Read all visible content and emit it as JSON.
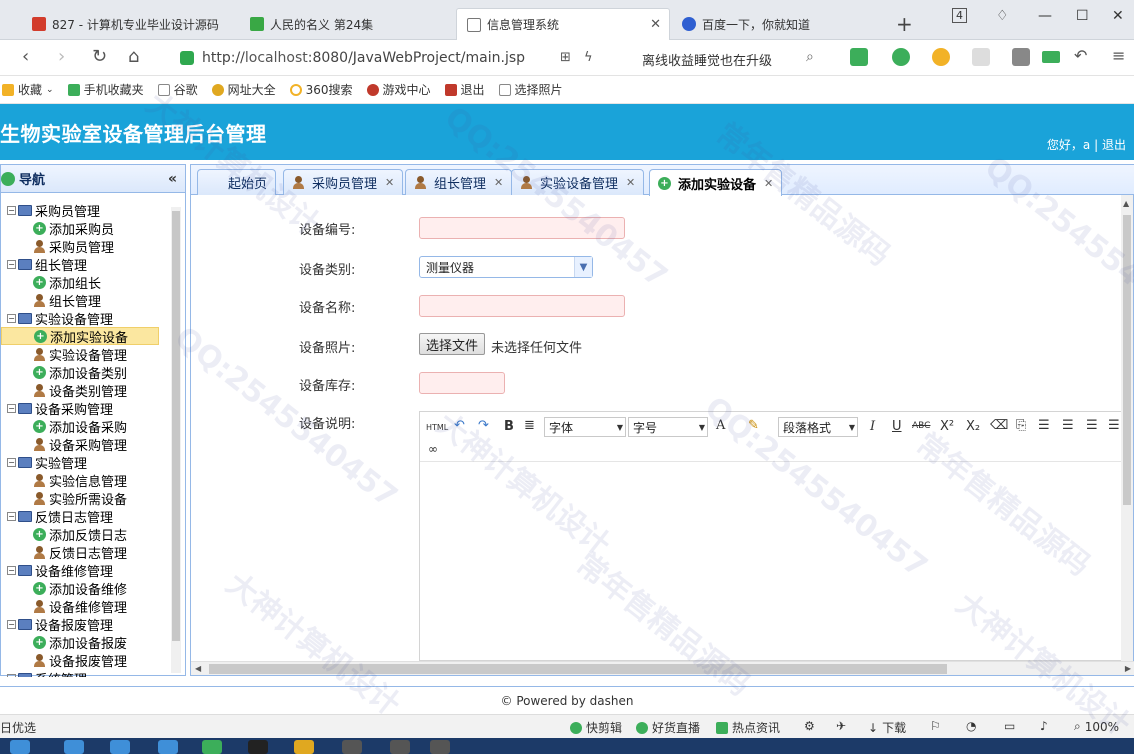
{
  "browser": {
    "tabs": [
      {
        "title": "827 - 计算机专业毕业设计源码"
      },
      {
        "title": "人民的名义 第24集"
      },
      {
        "title": "信息管理系统"
      },
      {
        "title": "百度一下，你就知道"
      }
    ],
    "tab_count_badge": "4",
    "url": {
      "prefix": "http://",
      "host": "localhost",
      "rest": ":8080/JavaWebProject/main.jsp"
    },
    "promo_text": "离线收益睡觉也在升级",
    "bookmarks": [
      "收藏",
      "手机收藏夹",
      "谷歌",
      "网址大全",
      "360搜索",
      "游戏中心",
      "退出",
      "选择照片"
    ]
  },
  "app": {
    "title": "生物实验室设备管理后台管理",
    "greeting": "您好，a",
    "separator": "|",
    "logout": "退出"
  },
  "sidebar": {
    "title": "导航",
    "collapse_glyph": "«",
    "groups": [
      {
        "label": "采购员管理",
        "children": [
          {
            "label": "添加采购员",
            "type": "add"
          },
          {
            "label": "采购员管理",
            "type": "user"
          }
        ]
      },
      {
        "label": "组长管理",
        "children": [
          {
            "label": "添加组长",
            "type": "add"
          },
          {
            "label": "组长管理",
            "type": "user"
          }
        ]
      },
      {
        "label": "实验设备管理",
        "children": [
          {
            "label": "添加实验设备",
            "type": "add"
          },
          {
            "label": "实验设备管理",
            "type": "user"
          },
          {
            "label": "添加设备类别",
            "type": "add"
          },
          {
            "label": "设备类别管理",
            "type": "user"
          }
        ]
      },
      {
        "label": "设备采购管理",
        "children": [
          {
            "label": "添加设备采购",
            "type": "add"
          },
          {
            "label": "设备采购管理",
            "type": "user"
          }
        ]
      },
      {
        "label": "实验管理",
        "children": [
          {
            "label": "实验信息管理",
            "type": "user"
          },
          {
            "label": "实验所需设备",
            "type": "user"
          }
        ]
      },
      {
        "label": "反馈日志管理",
        "children": [
          {
            "label": "添加反馈日志",
            "type": "add"
          },
          {
            "label": "反馈日志管理",
            "type": "user"
          }
        ]
      },
      {
        "label": "设备维修管理",
        "children": [
          {
            "label": "添加设备维修",
            "type": "add"
          },
          {
            "label": "设备维修管理",
            "type": "user"
          }
        ]
      },
      {
        "label": "设备报废管理",
        "children": [
          {
            "label": "添加设备报废",
            "type": "add"
          },
          {
            "label": "设备报废管理",
            "type": "user"
          }
        ]
      },
      {
        "label": "系统管理",
        "children": []
      }
    ]
  },
  "panel_tabs": [
    {
      "label": "起始页",
      "closable": false
    },
    {
      "label": "采购员管理",
      "closable": true
    },
    {
      "label": "组长管理",
      "closable": true
    },
    {
      "label": "实验设备管理",
      "closable": true
    },
    {
      "label": "添加实验设备",
      "closable": true
    }
  ],
  "form": {
    "equipment_no_label": "设备编号:",
    "equipment_no_value": "",
    "category_label": "设备类别:",
    "category_value": "测量仪器",
    "name_label": "设备名称:",
    "name_value": "",
    "photo_label": "设备照片:",
    "file_button": "选择文件",
    "file_status": "未选择任何文件",
    "stock_label": "设备库存:",
    "stock_value": "",
    "desc_label": "设备说明:"
  },
  "editor_toolbar": {
    "html": "HTML",
    "bold": "B",
    "font": "字体",
    "size": "字号",
    "font_color": "A",
    "paragraph": "段落格式",
    "italic": "I",
    "underline": "U",
    "strike": "ABC",
    "superscript": "X²",
    "subscript": "X₂"
  },
  "footer": "© Powered by dashen",
  "statusbar": {
    "left": "日优选",
    "items": [
      "快剪辑",
      "好货直播",
      "热点资讯",
      "下载"
    ],
    "zoom": "100%"
  },
  "watermark": {
    "lines": [
      "大神计算机设计",
      "QQ:2545540457",
      "常年售精品源码"
    ]
  },
  "colors": {
    "header": "#1aa3d9",
    "panel_border": "#95b8e7",
    "selected_node": "#fbe7a0",
    "required_field": "#ffeeee"
  }
}
